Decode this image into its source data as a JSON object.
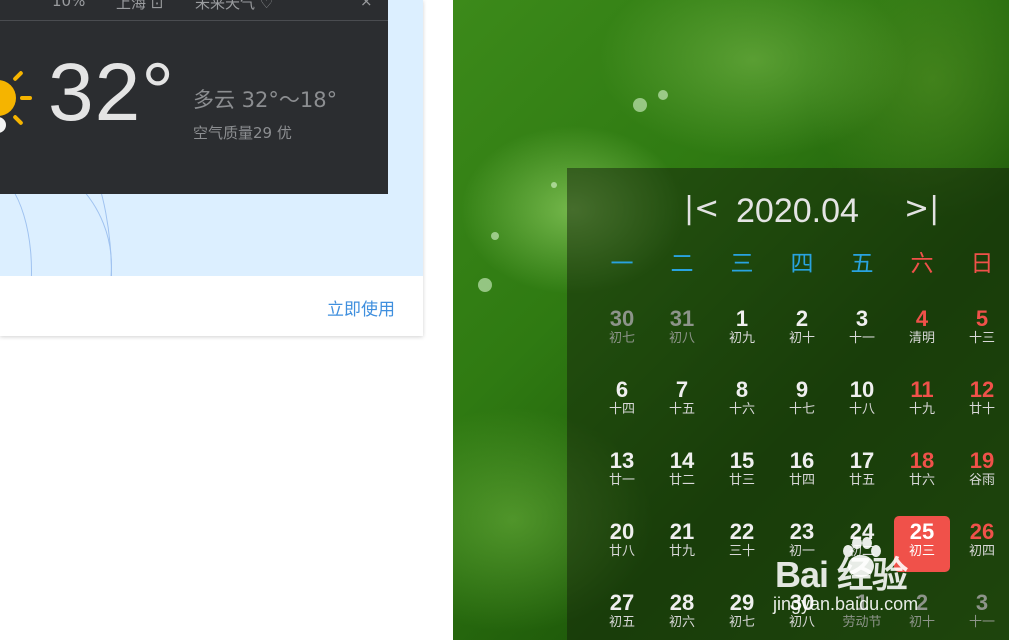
{
  "weather_card": {
    "top_bar": {
      "humidity": "10%",
      "city": "上海 ⊡",
      "app_name": "未来天气 ♡",
      "close_label": "×"
    },
    "temperature": "32°",
    "condition": "多云 32°～18°",
    "air_quality": "空气质量29 优",
    "use_link": "立即使用"
  },
  "calendar": {
    "title": "2020.04",
    "prev_label": "|<",
    "next_label": ">|",
    "weekdays": [
      "一",
      "二",
      "三",
      "四",
      "五",
      "六",
      "日"
    ],
    "weekday_colors": {
      "weekday": "#29a3e0",
      "weekend": "#f0514a"
    },
    "today_color": "#f0514a",
    "rows": [
      [
        {
          "d": "30",
          "l": "初七",
          "t": "other"
        },
        {
          "d": "31",
          "l": "初八",
          "t": "other"
        },
        {
          "d": "1",
          "l": "初九",
          "t": "normal"
        },
        {
          "d": "2",
          "l": "初十",
          "t": "normal"
        },
        {
          "d": "3",
          "l": "十一",
          "t": "normal"
        },
        {
          "d": "4",
          "l": "清明",
          "t": "weekend"
        },
        {
          "d": "5",
          "l": "十三",
          "t": "weekend"
        }
      ],
      [
        {
          "d": "6",
          "l": "十四",
          "t": "normal"
        },
        {
          "d": "7",
          "l": "十五",
          "t": "normal"
        },
        {
          "d": "8",
          "l": "十六",
          "t": "normal"
        },
        {
          "d": "9",
          "l": "十七",
          "t": "normal"
        },
        {
          "d": "10",
          "l": "十八",
          "t": "normal"
        },
        {
          "d": "11",
          "l": "十九",
          "t": "weekend"
        },
        {
          "d": "12",
          "l": "廿十",
          "t": "weekend"
        }
      ],
      [
        {
          "d": "13",
          "l": "廿一",
          "t": "normal"
        },
        {
          "d": "14",
          "l": "廿二",
          "t": "normal"
        },
        {
          "d": "15",
          "l": "廿三",
          "t": "normal"
        },
        {
          "d": "16",
          "l": "廿四",
          "t": "normal"
        },
        {
          "d": "17",
          "l": "廿五",
          "t": "normal"
        },
        {
          "d": "18",
          "l": "廿六",
          "t": "weekend"
        },
        {
          "d": "19",
          "l": "谷雨",
          "t": "weekend"
        }
      ],
      [
        {
          "d": "20",
          "l": "廿八",
          "t": "normal"
        },
        {
          "d": "21",
          "l": "廿九",
          "t": "normal"
        },
        {
          "d": "22",
          "l": "三十",
          "t": "normal"
        },
        {
          "d": "23",
          "l": "初一",
          "t": "normal"
        },
        {
          "d": "24",
          "l": "初二",
          "t": "normal"
        },
        {
          "d": "25",
          "l": "初三",
          "t": "today"
        },
        {
          "d": "26",
          "l": "初四",
          "t": "weekend"
        }
      ],
      [
        {
          "d": "27",
          "l": "初五",
          "t": "normal"
        },
        {
          "d": "28",
          "l": "初六",
          "t": "normal"
        },
        {
          "d": "29",
          "l": "初七",
          "t": "normal"
        },
        {
          "d": "30",
          "l": "初八",
          "t": "normal"
        },
        {
          "d": "1",
          "l": "劳动节",
          "t": "other"
        },
        {
          "d": "2",
          "l": "初十",
          "t": "other"
        },
        {
          "d": "3",
          "l": "十一",
          "t": "other"
        }
      ]
    ]
  },
  "watermark": {
    "brand": "Bai  经验",
    "url": "jingyan.baidu.com"
  }
}
